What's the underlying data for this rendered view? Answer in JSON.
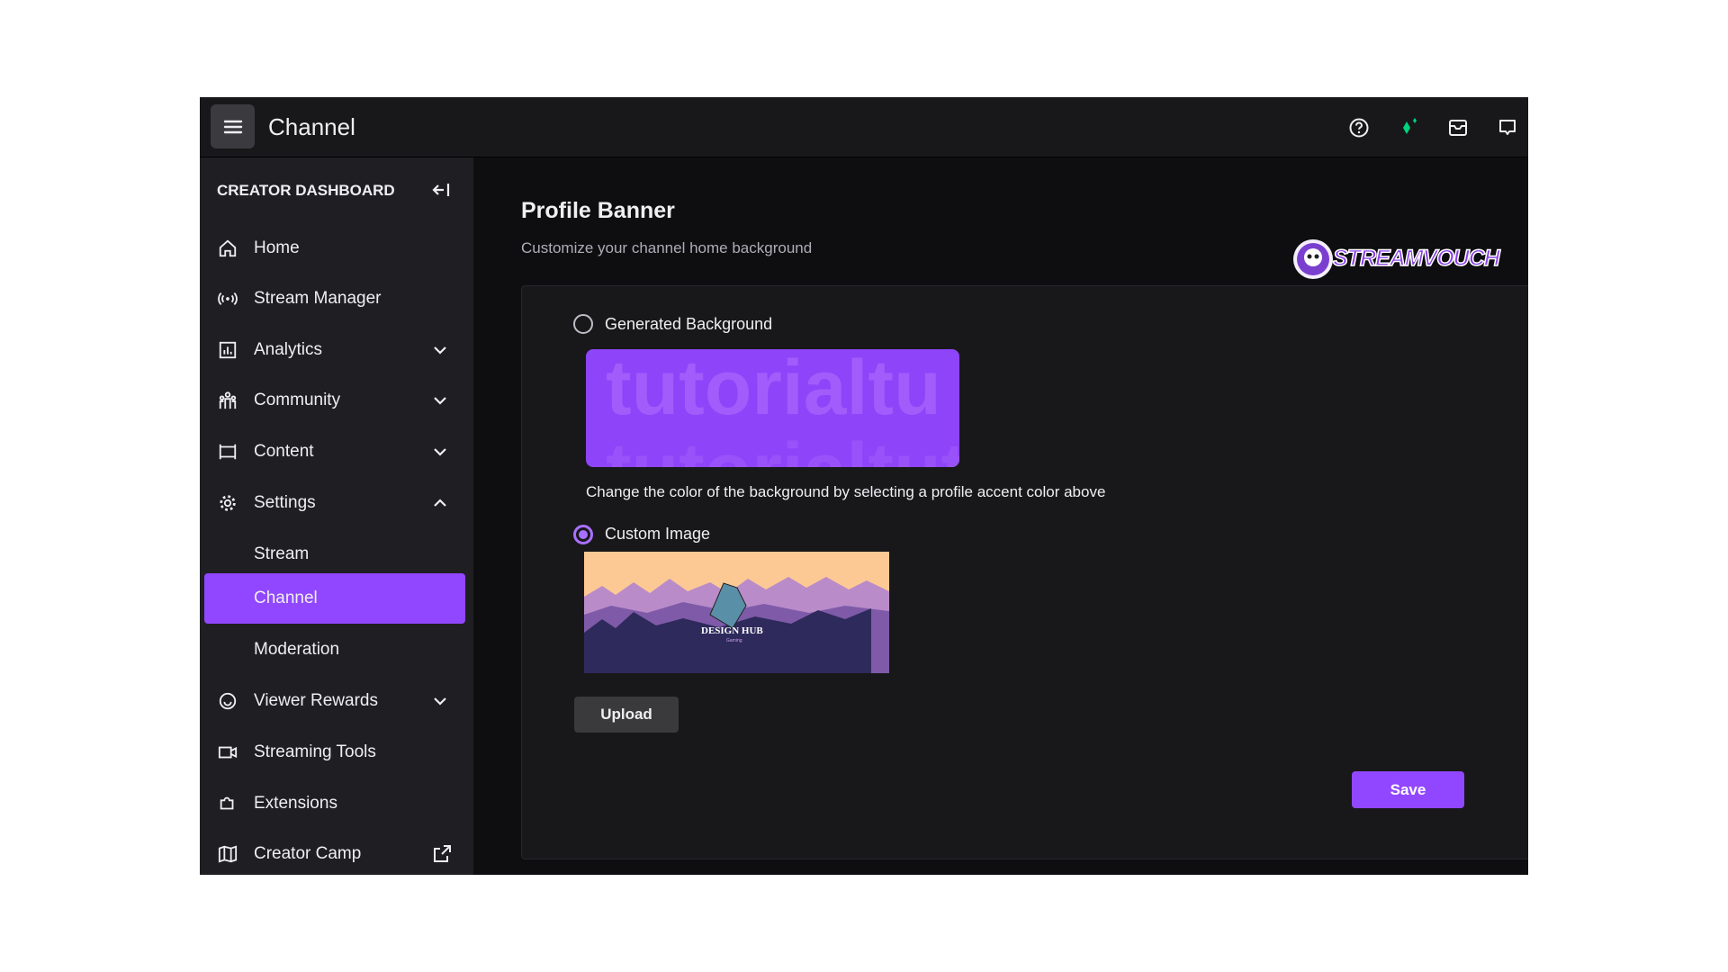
{
  "topbar": {
    "title": "Channel",
    "icons": [
      "menu-icon",
      "help-icon",
      "sparkle-icon",
      "inbox-icon",
      "chat-icon"
    ],
    "sparkle_color": "#00d47e"
  },
  "sidebar": {
    "header": "CREATOR DASHBOARD",
    "items": [
      {
        "label": "Home",
        "icon": "home-icon"
      },
      {
        "label": "Stream Manager",
        "icon": "broadcast-icon"
      },
      {
        "label": "Analytics",
        "icon": "chart-icon",
        "chevron": "down"
      },
      {
        "label": "Community",
        "icon": "people-icon",
        "chevron": "down"
      },
      {
        "label": "Content",
        "icon": "content-icon",
        "chevron": "down"
      },
      {
        "label": "Settings",
        "icon": "gear-icon",
        "chevron": "up"
      },
      {
        "label": "Stream"
      },
      {
        "label": "Channel",
        "active": true
      },
      {
        "label": "Moderation"
      },
      {
        "label": "Viewer Rewards",
        "icon": "rewards-icon",
        "chevron": "down"
      },
      {
        "label": "Streaming Tools",
        "icon": "camera-icon"
      },
      {
        "label": "Extensions",
        "icon": "puzzle-icon"
      },
      {
        "label": "Creator Camp",
        "icon": "book-icon",
        "external": true
      }
    ],
    "accent": "#9147ff"
  },
  "main": {
    "title": "Profile Banner",
    "subtitle": "Customize your channel home background",
    "watermark": "STREAMVOUCH",
    "generated_label": "Generated Background",
    "generated_preview_text": "tutorialtu",
    "generated_preview_text2": "tutorialtutor",
    "help_text": "Change the color of the background by selecting a profile accent color above",
    "custom_label": "Custom Image",
    "selected": "Custom Image",
    "banner_text": "DESIGN HUB",
    "banner_subtext": "Gaming",
    "upload_label": "Upload",
    "save_label": "Save"
  }
}
